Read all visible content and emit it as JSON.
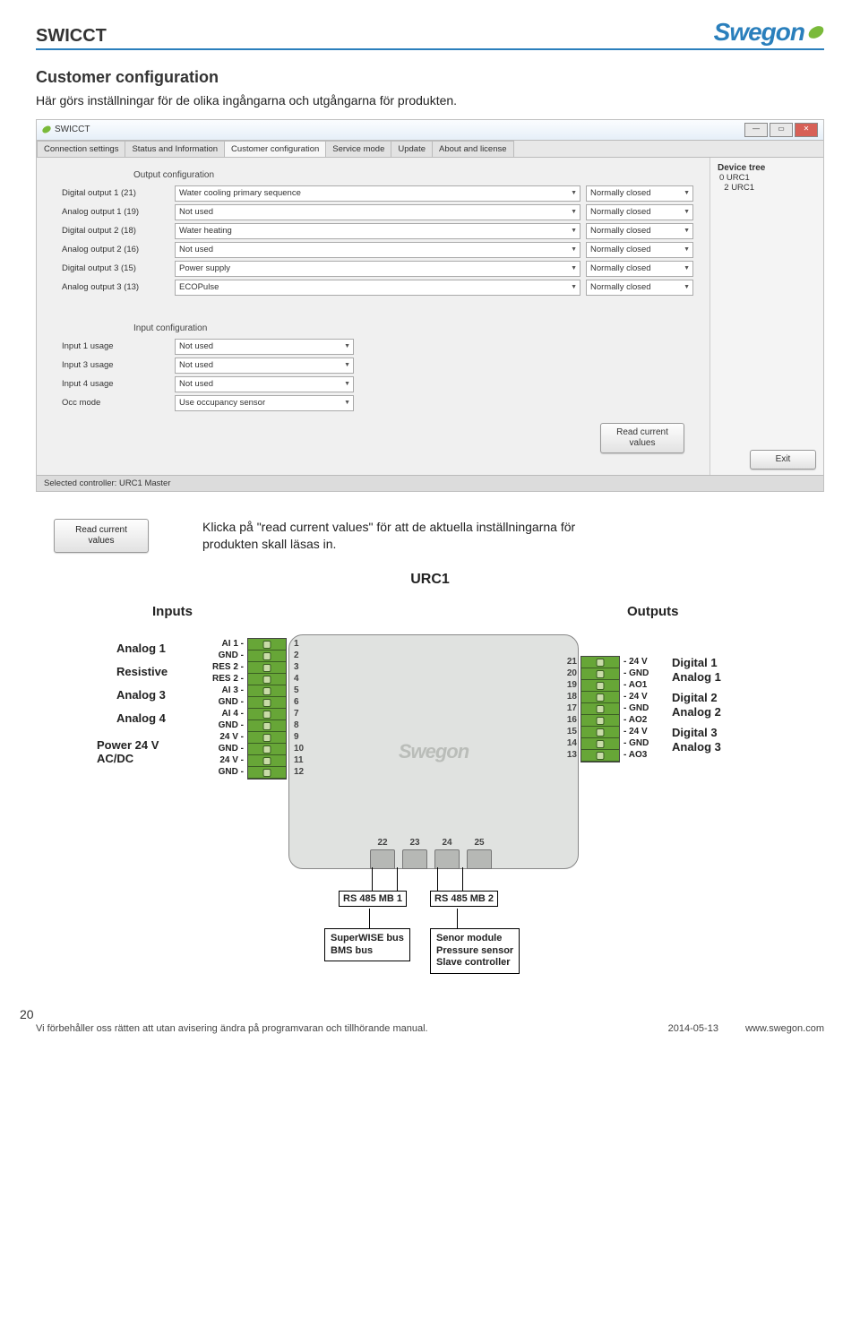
{
  "header": {
    "doc_title": "SWICCT",
    "brand": "Swegon"
  },
  "section": {
    "title": "Customer configuration",
    "intro": "Här görs inställningar för de olika ingångarna och utgångarna för produkten."
  },
  "window": {
    "title": "SWICCT",
    "tabs": [
      "Connection settings",
      "Status and Information",
      "Customer configuration",
      "Service mode",
      "Update",
      "About and license"
    ],
    "active_tab": 2,
    "output_title": "Output configuration",
    "outputs": [
      {
        "label": "Digital output 1 (21)",
        "value": "Water cooling primary sequence",
        "mode": "Normally closed"
      },
      {
        "label": "Analog output 1 (19)",
        "value": "Not used",
        "mode": "Normally closed"
      },
      {
        "label": "Digital output 2 (18)",
        "value": "Water heating",
        "mode": "Normally closed"
      },
      {
        "label": "Analog output 2 (16)",
        "value": "Not used",
        "mode": "Normally closed"
      },
      {
        "label": "Digital output 3 (15)",
        "value": "Power supply",
        "mode": "Normally closed"
      },
      {
        "label": "Analog output 3 (13)",
        "value": "ECOPulse",
        "mode": "Normally closed"
      }
    ],
    "input_title": "Input configuration",
    "inputs": [
      {
        "label": "Input 1 usage",
        "value": "Not used"
      },
      {
        "label": "Input 3 usage",
        "value": "Not used"
      },
      {
        "label": "Input 4 usage",
        "value": "Not used"
      },
      {
        "label": "Occ mode",
        "value": "Use occupancy sensor"
      }
    ],
    "read_button": "Read current\nvalues",
    "device_tree_title": "Device tree",
    "tree": [
      "0 URC1",
      "  2 URC1"
    ],
    "exit_button": "Exit",
    "status_bar": "Selected controller: URC1 Master"
  },
  "note": {
    "button": "Read current\nvalues",
    "text": "Klicka på \"read current values\" för att de aktuella inställningarna för produkten skall läsas in."
  },
  "diagram": {
    "title": "URC1",
    "inputs_header": "Inputs",
    "outputs_header": "Outputs",
    "left_labels": [
      "Analog 1",
      "Resistive",
      "Analog 3",
      "Analog 4",
      "Power 24 V\nAC/DC"
    ],
    "left_pins": [
      "AI 1 -",
      "GND -",
      "RES 2 -",
      "RES 2 -",
      "AI 3 -",
      "GND -",
      "AI 4 -",
      "GND -",
      "24 V -",
      "GND -",
      "24 V -",
      "GND -"
    ],
    "left_nums": [
      "1",
      "2",
      "3",
      "4",
      "5",
      "6",
      "7",
      "8",
      "9",
      "10",
      "11",
      "12"
    ],
    "right_nums": [
      "21",
      "20",
      "19",
      "18",
      "17",
      "16",
      "15",
      "14",
      "13"
    ],
    "right_pins": [
      "- 24 V",
      "- GND",
      "- AO1",
      "- 24 V",
      "- GND",
      "- AO2",
      "- 24 V",
      "- GND",
      "- AO3"
    ],
    "right_labels": [
      "Digital 1",
      "Analog 1",
      "Digital 2",
      "Analog 2",
      "Digital 3",
      "Analog 3"
    ],
    "bus_nums": [
      "22",
      "23",
      "24",
      "25"
    ],
    "bus_labels": [
      "RS 485 MB 1",
      "RS 485 MB 2"
    ],
    "callout_left": "SuperWISE bus\nBMS bus",
    "callout_right": "Senor module\nPressure sensor\nSlave controller"
  },
  "footer": {
    "page": "20",
    "text": "Vi förbehåller oss rätten att utan avisering ändra på programvaran och tillhörande manual.",
    "date": "2014-05-13",
    "url": "www.swegon.com"
  }
}
